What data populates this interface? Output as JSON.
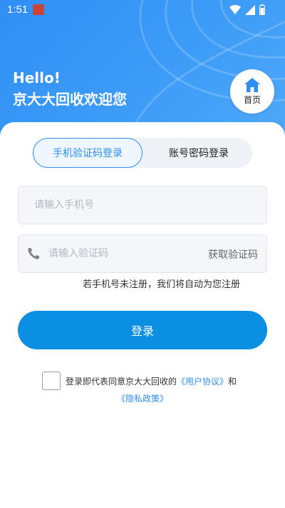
{
  "status_bar": {
    "time": "1:51",
    "icons": [
      "app-notification-icon",
      "wifi-icon",
      "signal-icon",
      "battery-icon"
    ]
  },
  "header": {
    "greeting_line1": "Hello!",
    "greeting_line2": "京大大回收欢迎您",
    "home_label": "首页"
  },
  "tabs": {
    "sms_label": "手机验证码登录",
    "password_label": "账号密码登录",
    "active": "sms"
  },
  "phone_field": {
    "placeholder": "请输入手机号",
    "value": ""
  },
  "code_field": {
    "placeholder": "请输入验证码",
    "value": "",
    "get_code_label": "获取验证码"
  },
  "hint": "若手机号未注册，我们将自动为您注册",
  "login_button": "登录",
  "agreement": {
    "prefix": "登录即代表同意京大大回收的",
    "user_agreement": "《用户协议》",
    "and": "和",
    "privacy_policy": "《隐私政策》",
    "checked": false
  },
  "colors": {
    "primary": "#2f8ff5",
    "button": "#0b8fe3",
    "input_bg": "#f4f6fa"
  }
}
